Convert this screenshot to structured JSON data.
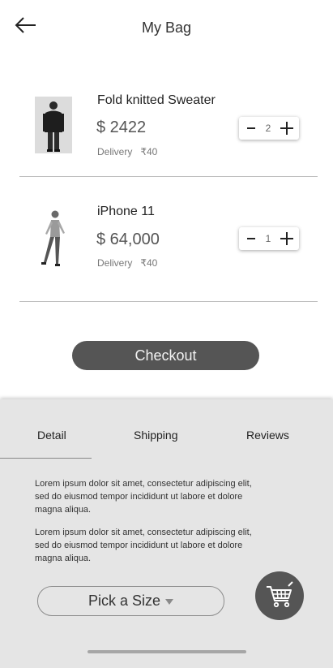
{
  "header": {
    "title": "My Bag"
  },
  "items": [
    {
      "name": "Fold knitted Sweater",
      "price": "$ 2422",
      "delivery_label": "Delivery",
      "delivery_fee": "₹40",
      "quantity": "2"
    },
    {
      "name": "iPhone 11",
      "price": "$ 64,000",
      "delivery_label": "Delivery",
      "delivery_fee": "₹40",
      "quantity": "1"
    }
  ],
  "checkout_label": "Checkout",
  "tabs": {
    "detail": "Detail",
    "shipping": "Shipping",
    "reviews": "Reviews",
    "active": "Detail"
  },
  "detail_paragraphs": [
    "Lorem ipsum dolor sit amet, consectetur adipiscing elit, sed do eiusmod tempor incididunt ut labore et dolore magna aliqua.",
    "Lorem ipsum dolor sit amet, consectetur adipiscing elit, sed do eiusmod tempor incididunt ut labore et dolore magna aliqua."
  ],
  "size_picker_label": "Pick a Size",
  "icons": {
    "back": "arrow-left-icon",
    "cart": "cart-icon",
    "dropdown": "caret-down-icon"
  },
  "colors": {
    "primary": "#555555",
    "sheet_bg": "#e5e5e5"
  }
}
